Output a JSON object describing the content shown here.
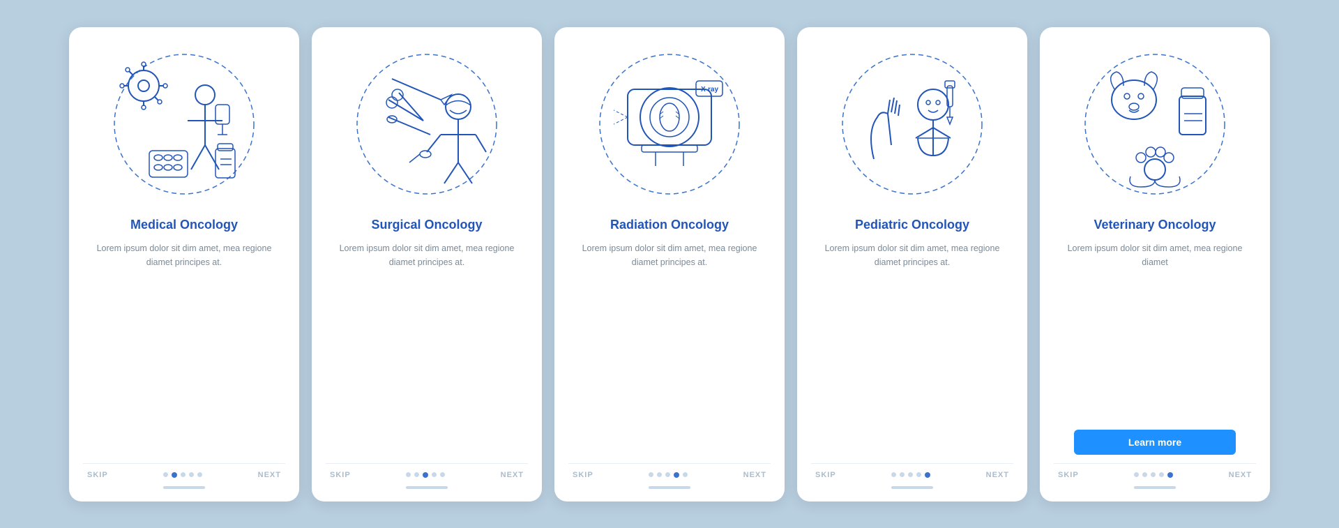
{
  "cards": [
    {
      "id": "medical-oncology",
      "title": "Medical\nOncology",
      "body": "Lorem ipsum dolor sit dim amet, mea regione diamet principes at.",
      "skip_label": "SKIP",
      "next_label": "NEXT",
      "dots": [
        false,
        true,
        false,
        false,
        false
      ],
      "has_learn_more": false,
      "active_dot": 1
    },
    {
      "id": "surgical-oncology",
      "title": "Surgical\nOncology",
      "body": "Lorem ipsum dolor sit dim amet, mea regione diamet principes at.",
      "skip_label": "SKIP",
      "next_label": "NEXT",
      "dots": [
        false,
        false,
        true,
        false,
        false
      ],
      "has_learn_more": false,
      "active_dot": 2
    },
    {
      "id": "radiation-oncology",
      "title": "Radiation\nOncology",
      "body": "Lorem ipsum dolor sit dim amet, mea regione diamet principes at.",
      "skip_label": "SKIP",
      "next_label": "NEXT",
      "dots": [
        false,
        false,
        false,
        true,
        false
      ],
      "has_learn_more": false,
      "active_dot": 3
    },
    {
      "id": "pediatric-oncology",
      "title": "Pediatric\nOncology",
      "body": "Lorem ipsum dolor sit dim amet, mea regione diamet principes at.",
      "skip_label": "SKIP",
      "next_label": "NEXT",
      "dots": [
        false,
        false,
        false,
        false,
        true
      ],
      "has_learn_more": false,
      "active_dot": 4
    },
    {
      "id": "veterinary-oncology",
      "title": "Veterinary\nOncology",
      "body": "Lorem ipsum dolor sit dim amet, mea regione diamet",
      "skip_label": "SKIP",
      "next_label": "NEXT",
      "dots": [
        false,
        false,
        false,
        false,
        true
      ],
      "has_learn_more": true,
      "learn_more_label": "Learn more",
      "active_dot": 4
    }
  ]
}
